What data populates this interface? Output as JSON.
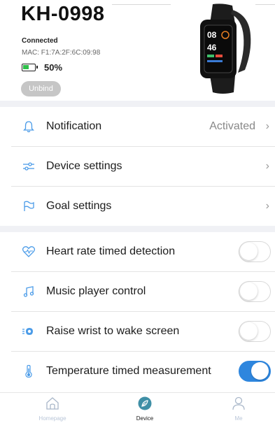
{
  "device": {
    "name": "KH-0998",
    "status": "Connected",
    "mac": "MAC: F1:7A:2F:6C:09:98",
    "battery": "50%",
    "battery_level": 0.5,
    "unbind_label": "Unbind"
  },
  "settings": [
    {
      "icon": "bell-icon",
      "label": "Notification",
      "value": "Activated"
    },
    {
      "icon": "sliders-icon",
      "label": "Device settings",
      "value": ""
    },
    {
      "icon": "flag-icon",
      "label": "Goal settings",
      "value": ""
    }
  ],
  "toggles": [
    {
      "icon": "heart-rate-icon",
      "label": "Heart rate timed detection",
      "on": false
    },
    {
      "icon": "music-note-icon",
      "label": "Music player control",
      "on": false
    },
    {
      "icon": "raise-wrist-icon",
      "label": "Raise wrist to wake screen",
      "on": false
    },
    {
      "icon": "thermometer-icon",
      "label": "Temperature timed measurement",
      "on": true
    }
  ],
  "tabbar": {
    "home": "Homepage",
    "device": "Device",
    "me": "Me",
    "active": "device"
  },
  "colors": {
    "accent": "#2e86de",
    "icon_blue": "#4a9be8",
    "section_bg": "#f0f1f5",
    "battery_green": "#2fbf4a"
  }
}
